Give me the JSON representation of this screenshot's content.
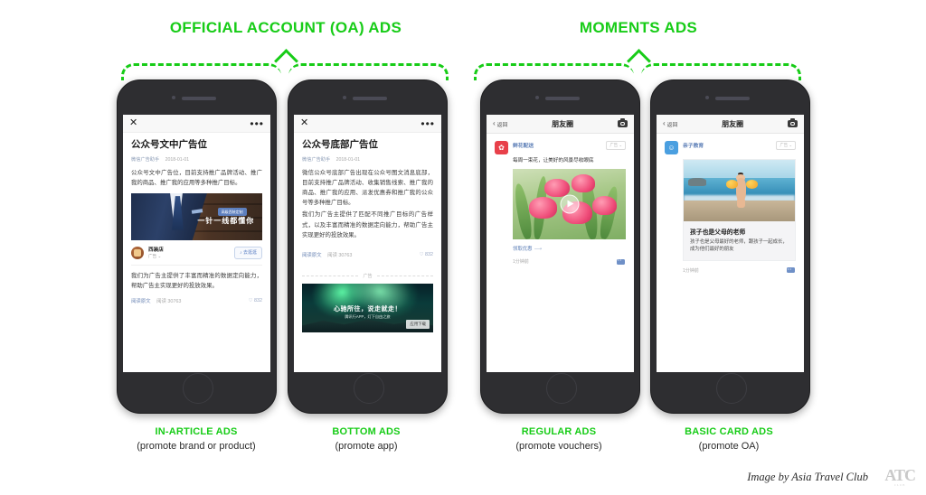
{
  "groups": {
    "oa": {
      "title": "OFFICIAL ACCOUNT (OA) ADS"
    },
    "moments": {
      "title": "MOMENTS ADS"
    }
  },
  "phones": {
    "p1": {
      "topbar": {
        "close": "✕",
        "more": "•••"
      },
      "article": {
        "title": "公众号文中广告位",
        "author": "微信广告助手",
        "date": "2018-01-01",
        "body": "公众号文中广告位，目前支持推广品牌活动、推广我的商品、推广我的应用等多种推广目标。",
        "body2": "我们为广告主提供了丰富而精准的数据定向能力，帮助广告主实现更好的投放效果。"
      },
      "banner": {
        "tag": "高级西装定制",
        "slogan": "一针一线都懂你"
      },
      "advertiser": {
        "name": "西装店",
        "sub": "广告 ⌄",
        "button": "♪ 去逛逛"
      },
      "footer": {
        "readmore": "阅读原文",
        "reads": "阅读 30763",
        "likes": "♡ 832"
      }
    },
    "p2": {
      "topbar": {
        "close": "✕",
        "more": "•••"
      },
      "article": {
        "title": "公众号底部广告位",
        "author": "微信广告助手",
        "date": "2018-01-01",
        "body": "微信公众号底部广告出现在公众号图文消息底部，目前支持推广品牌活动、收集销售线索、推广我的商品、推广我的应用、派发优惠券和推广我的公众号等多种推广目标。",
        "body2": "我们为广告主提供了匹配不同推广目标的广告样式，以及丰富而精准的数据定向能力，帮助广告主实现更好的投放效果。"
      },
      "footer": {
        "readmore": "阅读原文",
        "reads": "阅读 30763",
        "likes": "♡ 832"
      },
      "addivider": "广告",
      "appbanner": {
        "title": "心驰所往，说走就走！",
        "sub": "腾讯行APP，灯下自由之旅",
        "cta": "应用下载"
      }
    },
    "p3": {
      "topbar": {
        "back": "返回",
        "title": "朋友圈",
        "camera": "camera"
      },
      "post": {
        "account": "鲜花配送",
        "copy": "每周一束花，让美好的风景尽收眼底",
        "adtag": "广告 ⌄",
        "link": "领取优惠",
        "time": "1分钟前"
      }
    },
    "p4": {
      "topbar": {
        "back": "返回",
        "title": "朋友圈",
        "camera": "camera"
      },
      "post": {
        "account": "亲子教育",
        "adtag": "广告 ⌄",
        "card_title": "孩子也是父母的老师",
        "card_desc": "孩子也是父母最好的老师，跟孩子一起成长，成为他们最好的朋友",
        "time": "1分钟前"
      }
    }
  },
  "captions": [
    {
      "main": "IN-ARTICLE ADS",
      "sub": "(promote brand or product)"
    },
    {
      "main": "BOTTOM ADS",
      "sub": "(promote app)"
    },
    {
      "main": "REGULAR ADS",
      "sub": "(promote vouchers)"
    },
    {
      "main": "BASIC CARD ADS",
      "sub": "(promote OA)"
    }
  ],
  "credit": {
    "text": "Image by Asia Travel Club",
    "logo_mark": "ATC",
    "logo_sub": "CLUB"
  },
  "colors": {
    "green": "#17cc17",
    "phone_frame": "#2e2e31",
    "wechat_link": "#5d7fb7"
  }
}
